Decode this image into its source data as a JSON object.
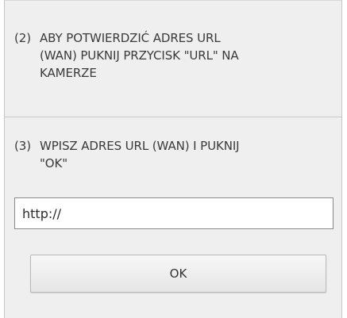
{
  "dialog": {
    "step2": {
      "number": "(2)",
      "lines": [
        "ABY POTWIERDZIĆ ADRES URL",
        "(WAN) PUKNIJ PRZYCISK \"URL\" NA",
        "KAMERZE"
      ]
    },
    "step3": {
      "number": "(3)",
      "lines": [
        "WPISZ ADRES URL (WAN) I PUKNIJ",
        "\"OK\""
      ]
    },
    "url_field": {
      "value": "http://"
    },
    "ok_button": {
      "label": "OK"
    }
  }
}
